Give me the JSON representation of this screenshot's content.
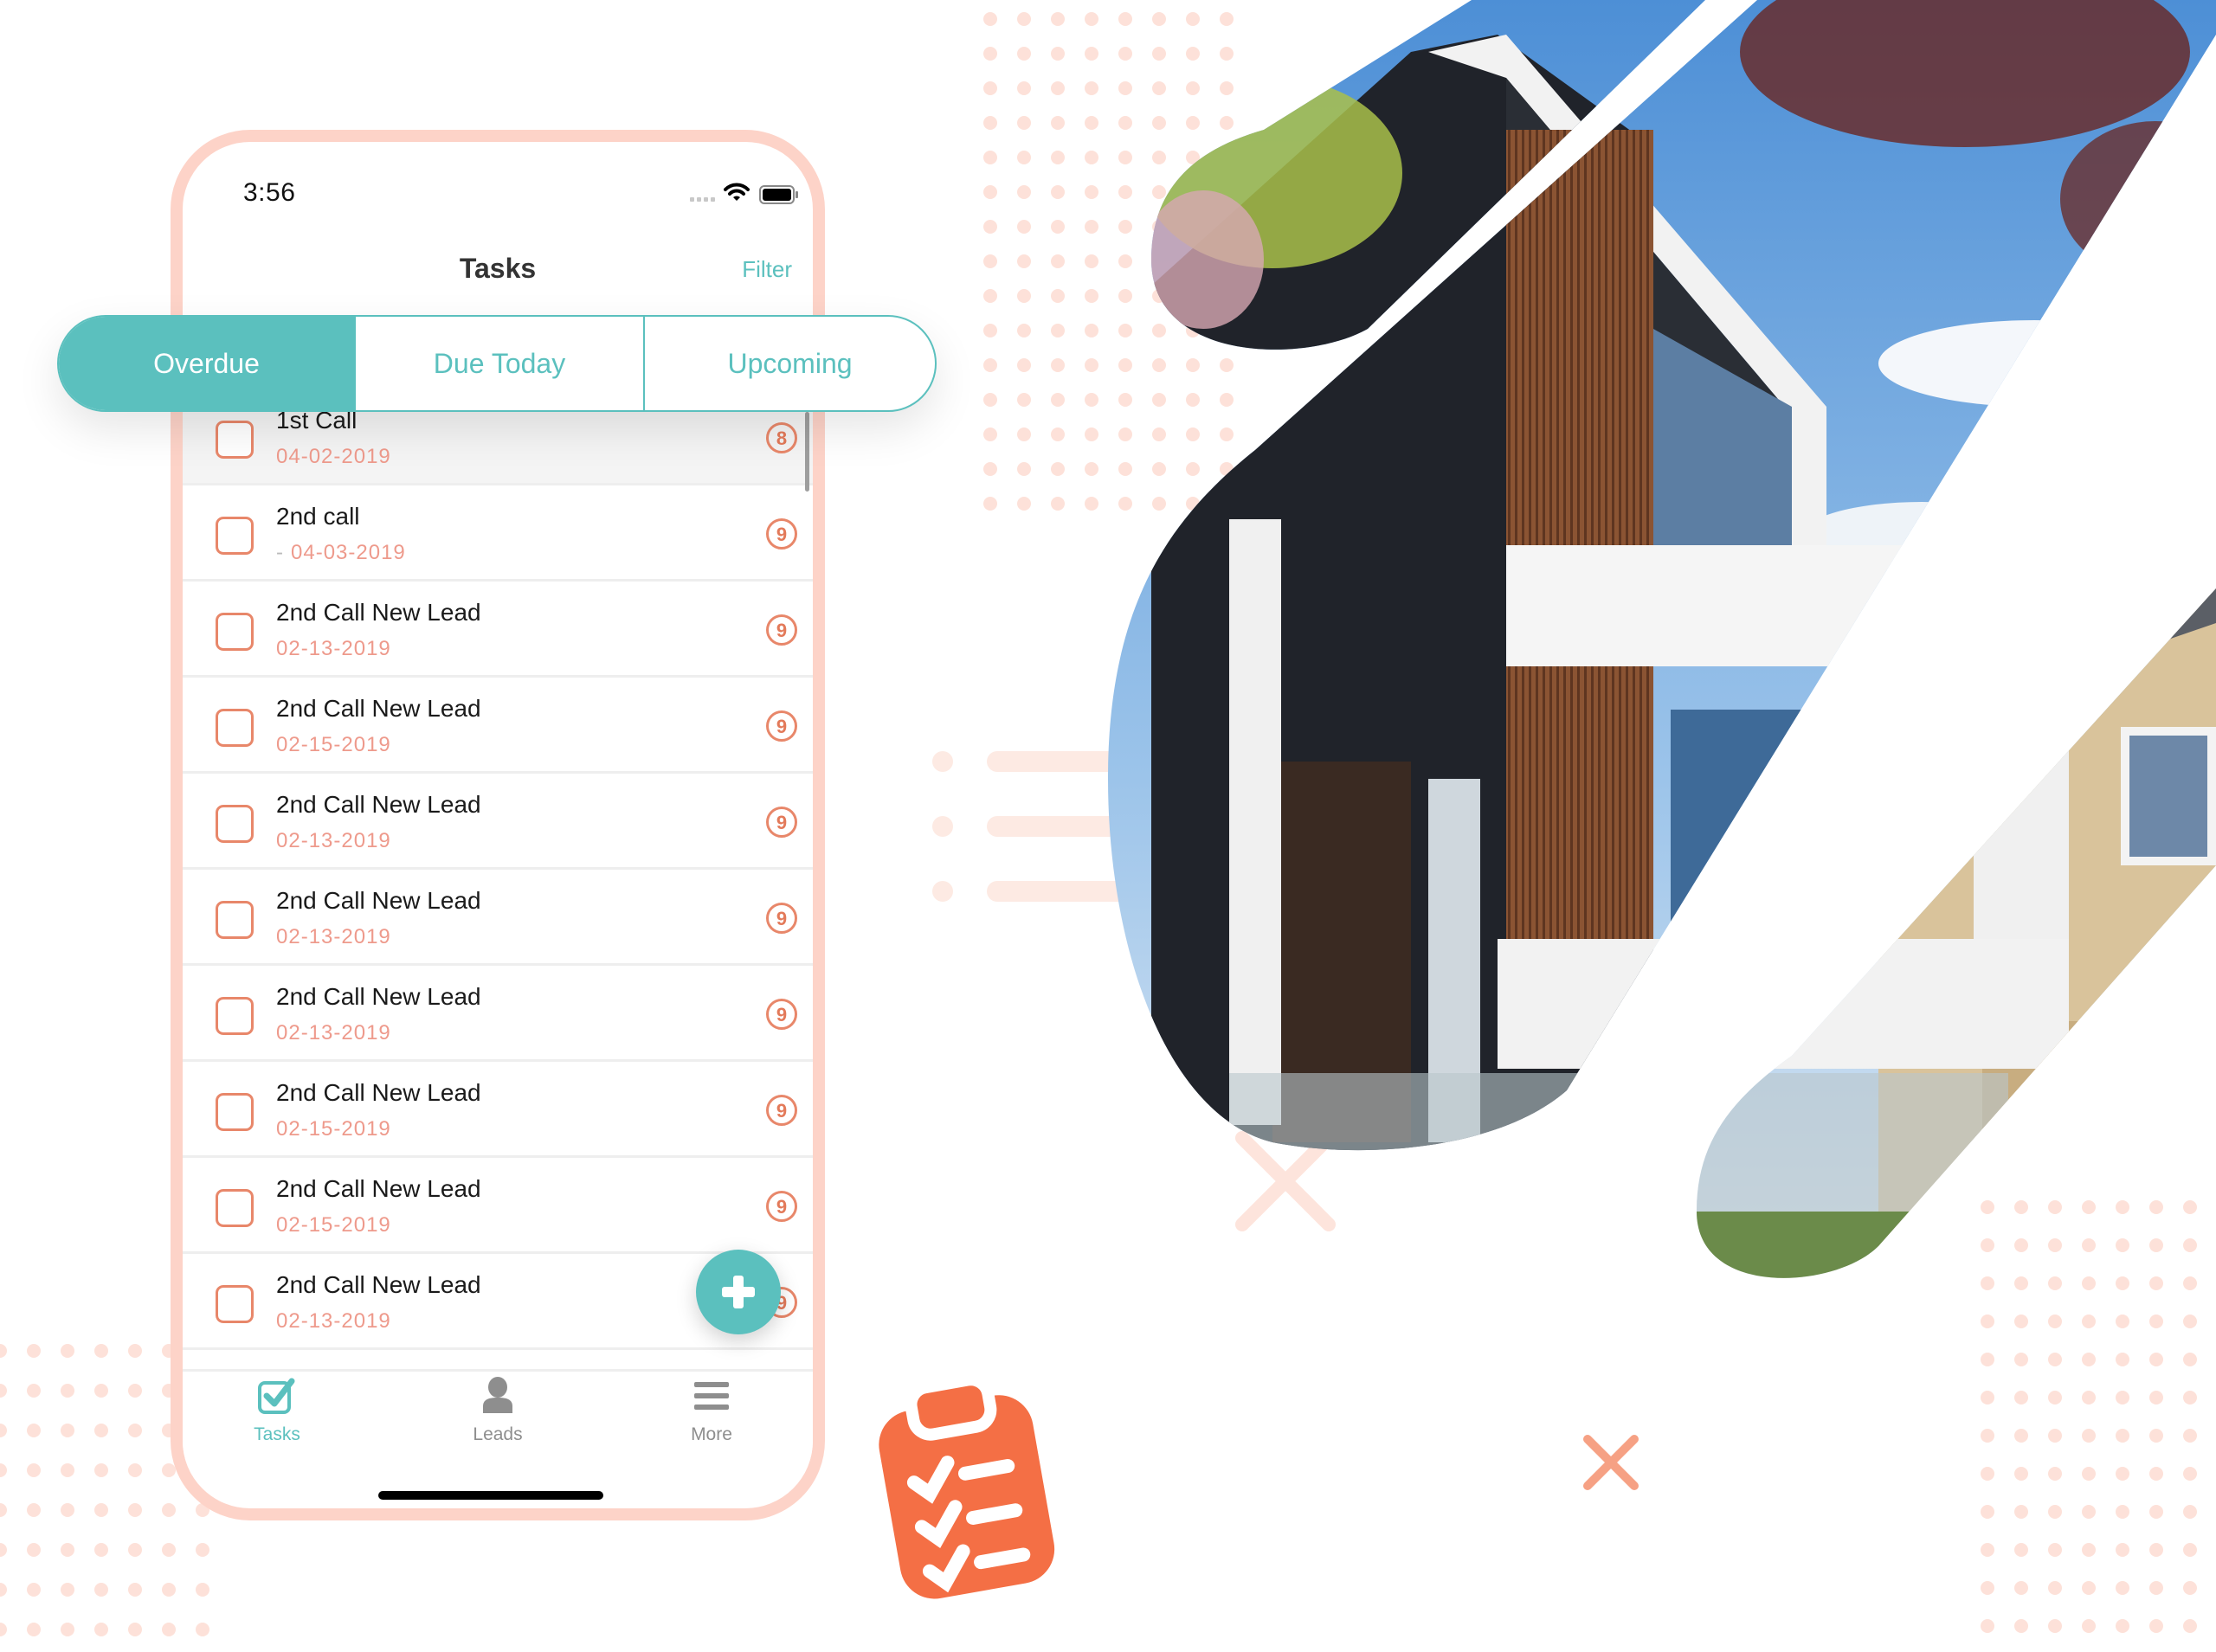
{
  "status_bar": {
    "time": "3:56"
  },
  "nav": {
    "title": "Tasks",
    "filter_label": "Filter"
  },
  "segments": [
    {
      "label": "Overdue",
      "active": true
    },
    {
      "label": "Due Today",
      "active": false
    },
    {
      "label": "Upcoming",
      "active": false
    }
  ],
  "tasks": [
    {
      "title": "1st Call",
      "date": "04-02-2019",
      "badge": "8",
      "dash": ""
    },
    {
      "title": "2nd call",
      "date": "04-03-2019",
      "badge": "9",
      "dash": "-"
    },
    {
      "title": "2nd Call New Lead",
      "date": "02-13-2019",
      "badge": "9",
      "dash": ""
    },
    {
      "title": "2nd Call New Lead",
      "date": "02-15-2019",
      "badge": "9",
      "dash": ""
    },
    {
      "title": "2nd Call New Lead",
      "date": "02-13-2019",
      "badge": "9",
      "dash": ""
    },
    {
      "title": "2nd Call New Lead",
      "date": "02-13-2019",
      "badge": "9",
      "dash": ""
    },
    {
      "title": "2nd Call New Lead",
      "date": "02-13-2019",
      "badge": "9",
      "dash": ""
    },
    {
      "title": "2nd Call New Lead",
      "date": "02-15-2019",
      "badge": "9",
      "dash": ""
    },
    {
      "title": "2nd Call New Lead",
      "date": "02-15-2019",
      "badge": "9",
      "dash": ""
    },
    {
      "title": "2nd Call New Lead",
      "date": "02-13-2019",
      "badge": "9",
      "dash": ""
    }
  ],
  "fab": {
    "icon": "plus-icon"
  },
  "tabbar": [
    {
      "label": "Tasks",
      "icon": "checkbox-icon",
      "active": true
    },
    {
      "label": "Leads",
      "icon": "person-icon",
      "active": false
    },
    {
      "label": "More",
      "icon": "menu-icon",
      "active": false
    }
  ],
  "decor": {
    "clipboard_icon": "clipboard-checklist-icon",
    "photo": "modern-house-photo"
  },
  "colors": {
    "accent": "#5bc0be",
    "coral": "#e8876a",
    "frame": "#fdd3c8",
    "dots": "#fde1d9",
    "clipboard": "#f46f45"
  }
}
